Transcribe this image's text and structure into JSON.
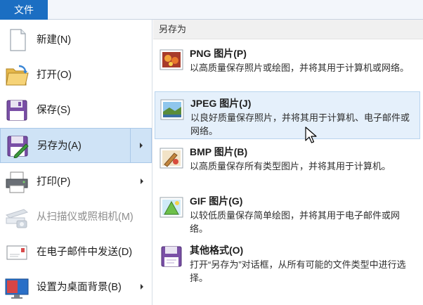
{
  "ribbon": {
    "file_tab": "文件"
  },
  "file_menu": {
    "items": [
      {
        "label": "新建(N)",
        "icon": "new-document-icon",
        "has_submenu": false,
        "enabled": true
      },
      {
        "label": "打开(O)",
        "icon": "open-folder-icon",
        "has_submenu": false,
        "enabled": true
      },
      {
        "label": "保存(S)",
        "icon": "save-disk-icon",
        "has_submenu": false,
        "enabled": true
      },
      {
        "label": "另存为(A)",
        "icon": "save-as-icon",
        "has_submenu": true,
        "enabled": true,
        "active": true
      },
      {
        "label": "打印(P)",
        "icon": "printer-icon",
        "has_submenu": true,
        "enabled": true
      },
      {
        "label": "从扫描仪或照相机(M)",
        "icon": "scanner-icon",
        "has_submenu": false,
        "enabled": false
      },
      {
        "label": "在电子邮件中发送(D)",
        "icon": "email-icon",
        "has_submenu": false,
        "enabled": true
      },
      {
        "label": "设置为桌面背景(B)",
        "icon": "desktop-background-icon",
        "has_submenu": true,
        "enabled": true
      }
    ]
  },
  "save_as_submenu": {
    "header": "另存为",
    "options": [
      {
        "title": "PNG 图片(P)",
        "description": "以高质量保存照片或绘图，并将其用于计算机或网络。",
        "icon": "png-image-icon",
        "highlighted": false
      },
      {
        "title": "JPEG 图片(J)",
        "description": "以良好质量保存照片，并将其用于计算机、电子邮件或网络。",
        "icon": "jpeg-image-icon",
        "highlighted": true
      },
      {
        "title": "BMP 图片(B)",
        "description": "以高质量保存所有类型图片，并将其用于计算机。",
        "icon": "bmp-image-icon",
        "highlighted": false
      },
      {
        "title": "GIF 图片(G)",
        "description": "以较低质量保存简单绘图，并将其用于电子邮件或网络。",
        "icon": "gif-image-icon",
        "highlighted": false
      },
      {
        "title": "其他格式(O)",
        "description": "打开“另存为”对话框，从所有可能的文件类型中进行选择。",
        "icon": "other-formats-icon",
        "highlighted": false
      }
    ]
  },
  "colors": {
    "accent": "#1b6ec2",
    "active_bg": "#cfe3f6",
    "hover_bg": "#e5f0fb",
    "disabled_text": "#8e8e8e"
  }
}
